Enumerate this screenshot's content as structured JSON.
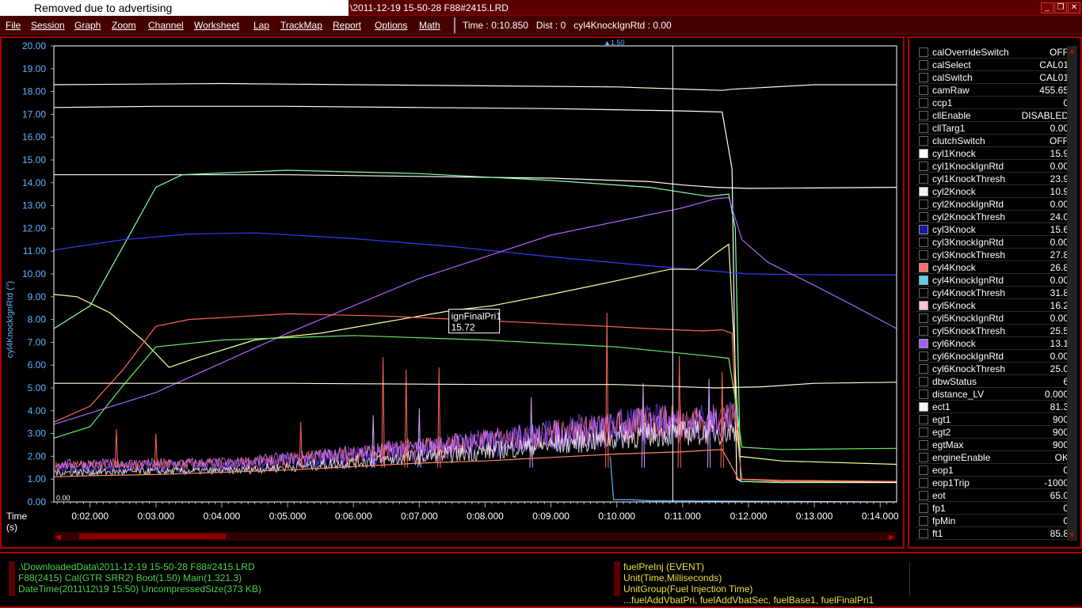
{
  "window": {
    "ad_text": "Removed due to advertising",
    "title": "\\2011-12-19 15-50-28 F88#2415.LRD",
    "min_label": "_",
    "restore_label": "❐",
    "close_label": "✕"
  },
  "menu": {
    "items": [
      "File",
      "Session",
      "Graph",
      "Zoom",
      "Channel",
      "Worksheet",
      "Lap",
      "TrackMap",
      "Report",
      "Options",
      "Math"
    ],
    "status": "Time : 0:10.850   Dist : 0   cyl4KnockIgnRtd : 0.00"
  },
  "graph": {
    "y_label": "cyl4KnockIgnRtd (°)",
    "y_ticks": [
      "20.00",
      "19.00",
      "18.00",
      "17.00",
      "16.00",
      "15.00",
      "14.00",
      "13.00",
      "12.00",
      "11.00",
      "10.00",
      "9.00",
      "8.00",
      "7.00",
      "6.00",
      "5.00",
      "4.00",
      "3.00",
      "2.00",
      "1.00",
      "0.00"
    ],
    "x_label_line1": "Time",
    "x_label_line2": "(s)",
    "x_ticks": [
      "0:02.000",
      "0:03.000",
      "0:04.000",
      "0:05.000",
      "0:06.000",
      "0:07.000",
      "0:08.000",
      "0:09.000",
      "0:10.000",
      "0:11.000",
      "0:12.000",
      "0:13.000",
      "0:14.000"
    ],
    "cursor_marker": "▲1.50",
    "zero_marker": "0.00",
    "tooltip_name": "ignFinalPri1",
    "tooltip_value": "15.72",
    "colors": {
      "y_axis": "#5fb4ff",
      "cursor": "#ffffff",
      "scroll_track": "#330000",
      "scroll_thumb": "#8a0000"
    }
  },
  "chart_data": {
    "type": "line",
    "xlabel": "Time (s)",
    "ylabel": "cyl4KnockIgnRtd (°)",
    "ylim": [
      0,
      20
    ],
    "xlim": [
      1.45,
      14.25
    ],
    "cursor_x": 10.85,
    "series": [
      {
        "color": "#ffffdd",
        "points": [
          [
            1.45,
            18.3
          ],
          [
            4.0,
            18.35
          ],
          [
            6.0,
            18.3
          ],
          [
            8.0,
            18.25
          ],
          [
            10.0,
            18.2
          ],
          [
            11.6,
            18.05
          ],
          [
            11.75,
            18.1
          ],
          [
            13.0,
            18.3
          ],
          [
            14.25,
            18.3
          ]
        ]
      },
      {
        "color": "#ffffff",
        "points": [
          [
            1.45,
            17.3
          ],
          [
            3.0,
            17.35
          ],
          [
            5.0,
            17.35
          ],
          [
            7.0,
            17.3
          ],
          [
            9.0,
            17.25
          ],
          [
            11.0,
            17.15
          ],
          [
            11.6,
            17.1
          ],
          [
            11.75,
            14.6
          ],
          [
            11.82,
            1.0
          ],
          [
            11.9,
            0.9
          ],
          [
            12.5,
            0.85
          ],
          [
            13.0,
            0.85
          ],
          [
            14.25,
            0.85
          ]
        ]
      },
      {
        "color": "#ffffff",
        "points": [
          [
            1.45,
            14.35
          ],
          [
            5.0,
            14.35
          ],
          [
            9.0,
            14.2
          ],
          [
            10.5,
            14.05
          ],
          [
            11.0,
            13.9
          ],
          [
            11.5,
            13.8
          ],
          [
            12.0,
            13.75
          ],
          [
            14.25,
            13.8
          ]
        ]
      },
      {
        "color": "#88ffaa",
        "points": [
          [
            1.45,
            7.6
          ],
          [
            2.0,
            8.6
          ],
          [
            2.5,
            11.2
          ],
          [
            3.0,
            13.8
          ],
          [
            3.4,
            14.35
          ],
          [
            5.0,
            14.55
          ],
          [
            7.0,
            14.4
          ],
          [
            9.0,
            14.1
          ],
          [
            10.5,
            13.8
          ],
          [
            11.4,
            13.4
          ],
          [
            11.7,
            13.5
          ],
          [
            11.8,
            12.0
          ],
          [
            11.88,
            0.9
          ],
          [
            12.5,
            0.85
          ],
          [
            14.25,
            0.9
          ]
        ]
      },
      {
        "color": "#3a3aff",
        "points": [
          [
            1.45,
            11.05
          ],
          [
            2.5,
            11.5
          ],
          [
            3.5,
            11.75
          ],
          [
            4.5,
            11.8
          ],
          [
            6.0,
            11.55
          ],
          [
            7.5,
            11.2
          ],
          [
            9.0,
            10.75
          ],
          [
            10.5,
            10.35
          ],
          [
            12.0,
            10.0
          ],
          [
            13.5,
            9.95
          ],
          [
            14.25,
            9.95
          ]
        ]
      },
      {
        "color": "#b060ff",
        "points": [
          [
            1.45,
            3.4
          ],
          [
            3.0,
            4.8
          ],
          [
            5.0,
            7.4
          ],
          [
            7.0,
            9.8
          ],
          [
            9.0,
            11.7
          ],
          [
            11.0,
            12.9
          ],
          [
            11.5,
            13.3
          ],
          [
            11.7,
            13.35
          ],
          [
            11.9,
            11.5
          ],
          [
            12.3,
            10.5
          ],
          [
            13.0,
            9.5
          ],
          [
            13.6,
            8.6
          ],
          [
            14.25,
            7.6
          ]
        ]
      },
      {
        "color": "#ffff99",
        "points": [
          [
            1.45,
            9.1
          ],
          [
            1.8,
            9.0
          ],
          [
            2.3,
            8.3
          ],
          [
            2.8,
            7.1
          ],
          [
            3.2,
            5.9
          ],
          [
            3.6,
            6.3
          ],
          [
            4.5,
            7.1
          ],
          [
            5.5,
            7.4
          ],
          [
            6.5,
            7.9
          ],
          [
            7.5,
            8.4
          ],
          [
            8.1,
            8.6
          ],
          [
            9.0,
            9.1
          ],
          [
            10.0,
            9.7
          ],
          [
            10.8,
            10.2
          ],
          [
            11.2,
            10.2
          ],
          [
            11.5,
            10.9
          ],
          [
            11.7,
            11.3
          ],
          [
            11.78,
            7.0
          ],
          [
            11.86,
            2.0
          ],
          [
            12.5,
            1.8
          ],
          [
            14.25,
            1.65
          ]
        ]
      },
      {
        "color": "#ff6655",
        "points": [
          [
            1.45,
            3.5
          ],
          [
            2.0,
            4.2
          ],
          [
            2.5,
            5.8
          ],
          [
            3.0,
            7.7
          ],
          [
            3.5,
            8.0
          ],
          [
            5.0,
            8.25
          ],
          [
            6.5,
            8.15
          ],
          [
            8.0,
            7.95
          ],
          [
            9.5,
            7.75
          ],
          [
            10.5,
            7.6
          ],
          [
            11.3,
            7.5
          ],
          [
            11.6,
            7.55
          ],
          [
            11.75,
            7.4
          ],
          [
            11.82,
            3.0
          ],
          [
            11.9,
            1.0
          ],
          [
            12.5,
            0.95
          ],
          [
            14.25,
            0.9
          ]
        ]
      },
      {
        "color": "#66ee66",
        "points": [
          [
            1.45,
            2.8
          ],
          [
            2.0,
            3.3
          ],
          [
            2.5,
            5.1
          ],
          [
            3.0,
            6.8
          ],
          [
            4.0,
            7.1
          ],
          [
            6.0,
            7.3
          ],
          [
            8.0,
            7.1
          ],
          [
            10.0,
            6.8
          ],
          [
            11.4,
            6.4
          ],
          [
            11.7,
            6.3
          ],
          [
            11.8,
            4.5
          ],
          [
            11.9,
            2.4
          ],
          [
            12.5,
            2.3
          ],
          [
            14.25,
            2.35
          ]
        ]
      },
      {
        "color": "#ffffdd",
        "points": [
          [
            1.45,
            5.2
          ],
          [
            5.0,
            5.2
          ],
          [
            8.0,
            5.15
          ],
          [
            10.0,
            5.15
          ],
          [
            11.5,
            5.0
          ],
          [
            12.2,
            5.05
          ],
          [
            13.0,
            5.2
          ],
          [
            14.25,
            5.25
          ]
        ]
      },
      {
        "color": "#ff8866",
        "points": [
          [
            1.45,
            1.1
          ],
          [
            2.0,
            1.15
          ],
          [
            3.0,
            1.2
          ],
          [
            4.0,
            1.3
          ],
          [
            5.0,
            1.4
          ],
          [
            6.0,
            1.55
          ],
          [
            7.0,
            1.7
          ],
          [
            8.0,
            1.8
          ],
          [
            9.0,
            1.95
          ],
          [
            10.0,
            2.1
          ],
          [
            11.0,
            2.2
          ],
          [
            11.6,
            2.3
          ],
          [
            11.85,
            1.0
          ],
          [
            12.5,
            0.9
          ],
          [
            14.25,
            0.9
          ]
        ]
      },
      {
        "color": "#5fb4ff",
        "points": [
          [
            9.9,
            2.0
          ],
          [
            9.95,
            0.1
          ],
          [
            10.2,
            0.1
          ],
          [
            10.5,
            0.05
          ],
          [
            14.25,
            0.0
          ]
        ]
      }
    ],
    "spikes": [
      {
        "color": "#ff6655",
        "x": [
          2.4,
          3.0,
          5.2,
          6.45,
          6.8,
          7.3,
          9.85,
          10.95,
          11.6
        ],
        "y": [
          3.2,
          3.0,
          3.5,
          6.35,
          5.8,
          5.9,
          8.3,
          6.4,
          5.7
        ]
      },
      {
        "color": "#d0a0ff",
        "x": [
          6.3,
          7.0,
          8.7,
          10.4,
          11.4
        ],
        "y": [
          3.8,
          4.1,
          4.6,
          5.2,
          5.4
        ]
      }
    ],
    "noise_bands": [
      {
        "color": "#ff6655",
        "base": 1.2,
        "amp": 1.6
      },
      {
        "color": "#6644ff",
        "base": 1.1,
        "amp": 1.8
      },
      {
        "color": "#e080ff",
        "base": 1.3,
        "amp": 1.5
      },
      {
        "color": "#ffffff",
        "base": 1.0,
        "amp": 1.1
      }
    ]
  },
  "channels": [
    {
      "name": "calOverrideSwitch",
      "value": "OFF",
      "swatch": ""
    },
    {
      "name": "calSelect",
      "value": "CAL01",
      "swatch": ""
    },
    {
      "name": "calSwitch",
      "value": "CAL01",
      "swatch": ""
    },
    {
      "name": "camRaw",
      "value": "455.65",
      "swatch": ""
    },
    {
      "name": "ccp1",
      "value": "0",
      "swatch": ""
    },
    {
      "name": "cllEnable",
      "value": "DISABLED",
      "swatch": ""
    },
    {
      "name": "cllTarg1",
      "value": "0.00",
      "swatch": ""
    },
    {
      "name": "clutchSwitch",
      "value": "OFF",
      "swatch": ""
    },
    {
      "name": "cyl1Knock",
      "value": "15.9",
      "swatch": "#ffffff"
    },
    {
      "name": "cyl1KnockIgnRtd",
      "value": "0.00",
      "swatch": ""
    },
    {
      "name": "cyl1KnockThresh",
      "value": "23.9",
      "swatch": ""
    },
    {
      "name": "cyl2Knock",
      "value": "10.9",
      "swatch": "#f4eef8"
    },
    {
      "name": "cyl2KnockIgnRtd",
      "value": "0.00",
      "swatch": ""
    },
    {
      "name": "cyl2KnockThresh",
      "value": "24.0",
      "swatch": ""
    },
    {
      "name": "cyl3Knock",
      "value": "15.6",
      "swatch": "#1a1aa0"
    },
    {
      "name": "cyl3KnockIgnRtd",
      "value": "0.00",
      "swatch": ""
    },
    {
      "name": "cyl3KnockThresh",
      "value": "27.8",
      "swatch": ""
    },
    {
      "name": "cyl4Knock",
      "value": "26.8",
      "swatch": "#ff7070"
    },
    {
      "name": "cyl4KnockIgnRtd",
      "value": "0.00",
      "swatch": "#5fd0f0"
    },
    {
      "name": "cyl4KnockThresh",
      "value": "31.8",
      "swatch": ""
    },
    {
      "name": "cyl5Knock",
      "value": "16.2",
      "swatch": "#ffc0d8"
    },
    {
      "name": "cyl5KnockIgnRtd",
      "value": "0.00",
      "swatch": ""
    },
    {
      "name": "cyl5KnockThresh",
      "value": "25.5",
      "swatch": ""
    },
    {
      "name": "cyl6Knock",
      "value": "13.1",
      "swatch": "#a060f0"
    },
    {
      "name": "cyl6KnockIgnRtd",
      "value": "0.00",
      "swatch": ""
    },
    {
      "name": "cyl6KnockThresh",
      "value": "25.0",
      "swatch": ""
    },
    {
      "name": "dbwStatus",
      "value": "6",
      "swatch": ""
    },
    {
      "name": "distance_LV",
      "value": "0.000",
      "swatch": ""
    },
    {
      "name": "ect1",
      "value": "81.3",
      "swatch": "#f0fff0"
    },
    {
      "name": "egt1",
      "value": "900",
      "swatch": ""
    },
    {
      "name": "egt2",
      "value": "900",
      "swatch": ""
    },
    {
      "name": "egtMax",
      "value": "900",
      "swatch": ""
    },
    {
      "name": "engineEnable",
      "value": "OK",
      "swatch": ""
    },
    {
      "name": "eop1",
      "value": "0",
      "swatch": ""
    },
    {
      "name": "eop1Trip",
      "value": "-1000",
      "swatch": ""
    },
    {
      "name": "eot",
      "value": "65.0",
      "swatch": ""
    },
    {
      "name": "fp1",
      "value": "0",
      "swatch": ""
    },
    {
      "name": "fpMin",
      "value": "0",
      "swatch": ""
    },
    {
      "name": "ft1",
      "value": "85.8",
      "swatch": ""
    }
  ],
  "bottom": {
    "left_lines": [
      ".\\DownloadedData\\2011-12-19 15-50-28 F88#2415.LRD",
      "F88(2415) Cal(GTR SRR2) Boot(1.50) Main(1.321.3)",
      "DateTime(2011\\12\\19 15:50) UncompressedSize(373 KB)"
    ],
    "right_lines": [
      "fuelPreInj (EVENT)",
      "Unit(Time,Milliseconds)",
      "UnitGroup(Fuel Injection Time)",
      "...fuelAddVbatPri, fuelAddVbatSec, fuelBase1, fuelFinalPri1"
    ]
  }
}
